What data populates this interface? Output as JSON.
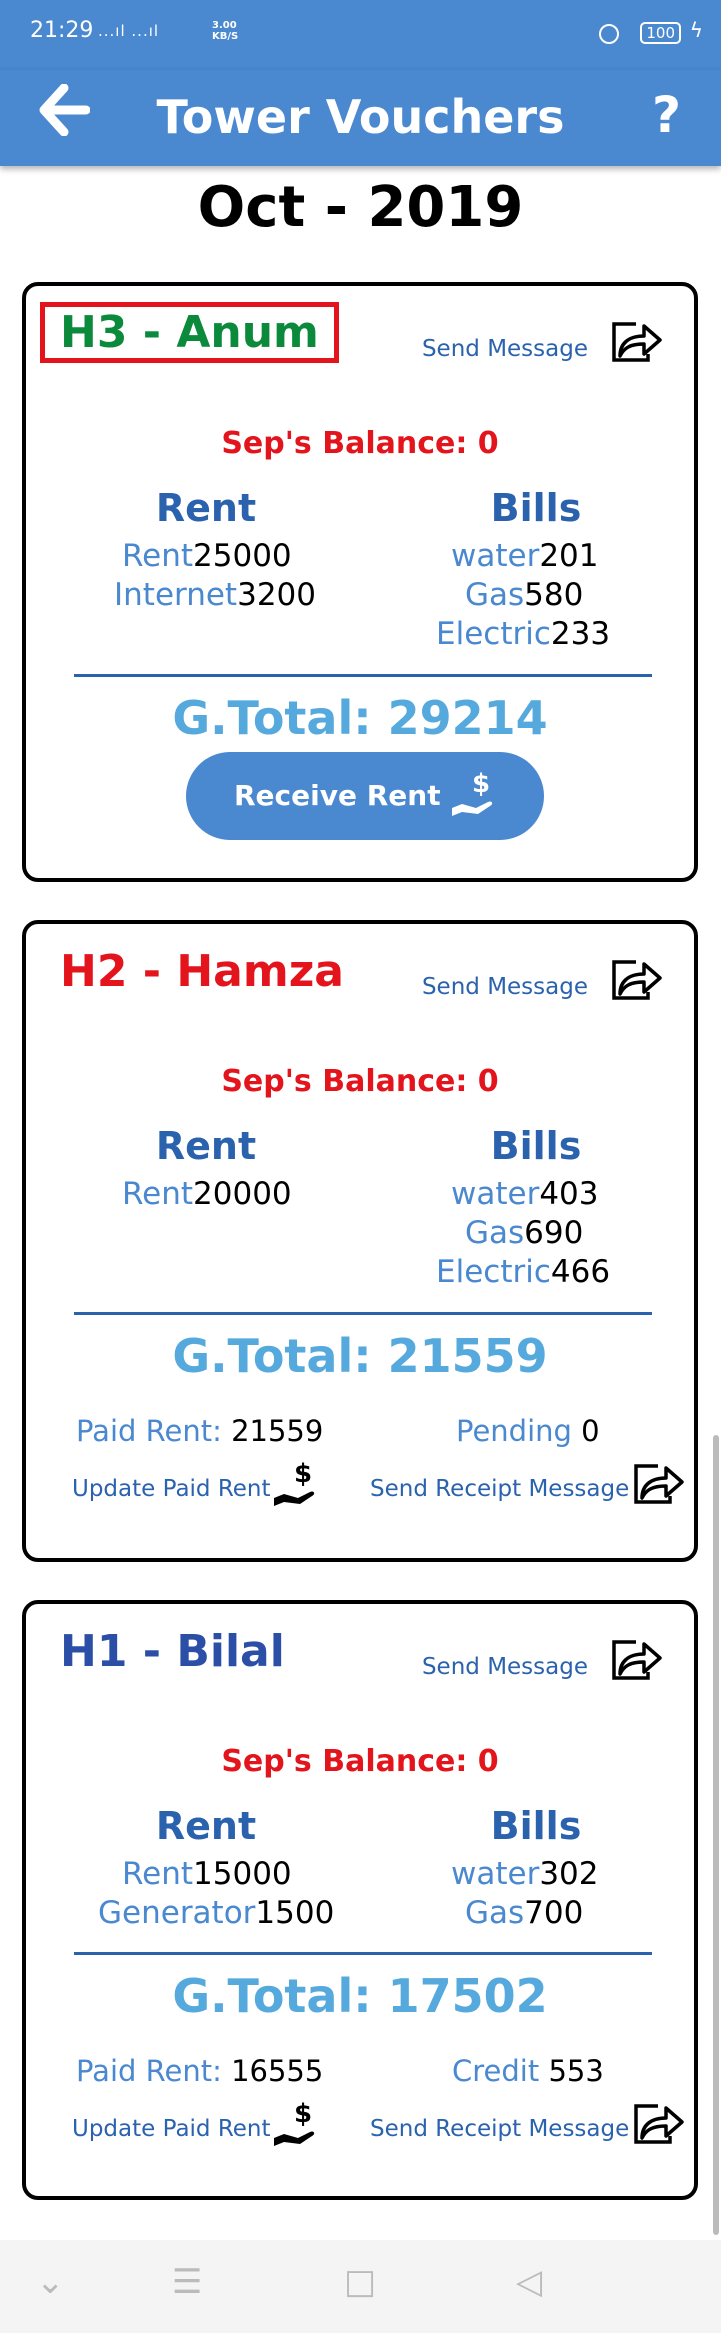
{
  "status": {
    "time": "21:29",
    "network": "...ıl ...ıl",
    "speed_top": "3.00",
    "speed_bottom": "KB/S",
    "battery": "100"
  },
  "appbar": {
    "title": "Tower Vouchers",
    "back_icon": "arrow-left-icon",
    "help_icon": "question-mark-icon"
  },
  "month": "Oct - 2019",
  "cards": [
    {
      "name": "H3 - Anum",
      "name_color": "#0b8a3c",
      "send_message": "Send Message",
      "balance": "Sep's Balance: 0",
      "rent_title": "Rent",
      "bills_title": "Bills",
      "rent_items": [
        {
          "label": "Rent",
          "value": "25000"
        },
        {
          "label": "Internet",
          "value": "3200"
        }
      ],
      "bill_items": [
        {
          "label": "water",
          "value": "201"
        },
        {
          "label": "Gas",
          "value": "580"
        },
        {
          "label": "Electric",
          "value": "233"
        }
      ],
      "g_total": "G.Total: 29214",
      "receive_button": "Receive Rent"
    },
    {
      "name": "H2 - Hamza",
      "name_color": "#e3141c",
      "send_message": "Send Message",
      "balance": "Sep's Balance: 0",
      "rent_title": "Rent",
      "bills_title": "Bills",
      "rent_items": [
        {
          "label": "Rent",
          "value": "20000"
        }
      ],
      "bill_items": [
        {
          "label": "water",
          "value": "403"
        },
        {
          "label": "Gas",
          "value": "690"
        },
        {
          "label": "Electric",
          "value": "466"
        }
      ],
      "g_total": "G.Total: 21559",
      "paid_label": "Paid Rent:",
      "paid_value": "21559",
      "status_label": "Pending",
      "status_value": "0",
      "update_paid": "Update Paid Rent",
      "send_receipt": "Send Receipt Message"
    },
    {
      "name": "H1 - Bilal",
      "name_color": "#2b4ea6",
      "send_message": "Send Message",
      "balance": "Sep's Balance: 0",
      "rent_title": "Rent",
      "bills_title": "Bills",
      "rent_items": [
        {
          "label": "Rent",
          "value": "15000"
        },
        {
          "label": "Generator",
          "value": "1500"
        }
      ],
      "bill_items": [
        {
          "label": "water",
          "value": "302"
        },
        {
          "label": "Gas",
          "value": "700"
        }
      ],
      "g_total": "G.Total: 17502",
      "paid_label": "Paid Rent:",
      "paid_value": "16555",
      "status_label": "Credit",
      "status_value": "553",
      "update_paid": "Update Paid Rent",
      "send_receipt": "Send Receipt Message"
    }
  ],
  "navbar": {
    "back": "◁",
    "home": "□",
    "recents": "☰",
    "down": "⌄"
  }
}
